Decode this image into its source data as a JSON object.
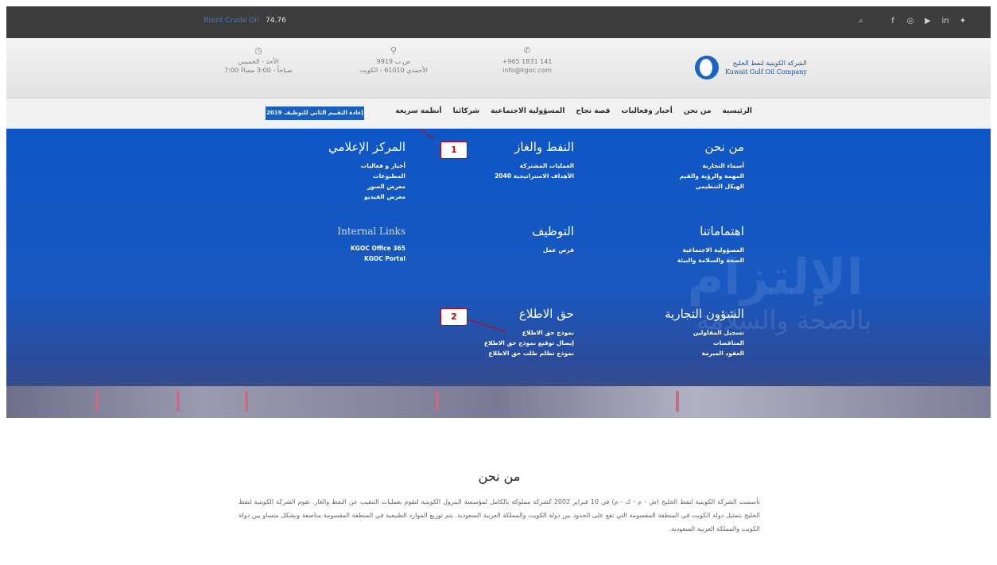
{
  "topbar": {
    "ticker_label": "Brent Crude Oil",
    "ticker_value": "74.76",
    "social_icons": [
      "search-icon",
      "facebook-icon",
      "instagram-icon",
      "youtube-icon",
      "linkedin-icon",
      "twitter-icon"
    ]
  },
  "header": {
    "logo_ar": "الشركة الكويتية لنفط الخليج",
    "logo_en": "Kuwait Gulf Oil Company",
    "hours_line1": "الأحد - الخميس",
    "hours_line2": "7:00 صباحاً - 3:00 مساءً",
    "address_line1": "ص.ب 9919",
    "address_line2": "الأحمدي 61010 - الكويت",
    "contact_line1": "+965 1831 141",
    "contact_line2": "info@kgoc.com"
  },
  "nav": {
    "items": [
      "الرئيسية",
      "من نحن",
      "أخبار وفعاليات",
      "قصة نجاح",
      "المسؤولية الاجتماعية",
      "شركائنا",
      "أنظمة سريعة"
    ],
    "cta": "إعادة التقييم الثاني للتوظيف 2019"
  },
  "mega": {
    "about": {
      "title": "من نحن",
      "links": [
        "أسماء التجارية",
        "المهمة والرؤية والقيم",
        "الهيكل التنظيمي"
      ]
    },
    "oil_gas": {
      "title": "النفط والغاز",
      "links": [
        "العمليات المشتركة",
        "الأهداف الاستراتيجية 2040"
      ]
    },
    "media": {
      "title": "المركز الإعلامي",
      "links": [
        "أخبار و فعاليات",
        "المطبوعات",
        "معرض الصور",
        "معرض الفيديو"
      ]
    },
    "interests": {
      "title": "اهتماماتنا",
      "links": [
        "المسؤولية الاجتماعية",
        "الصحة والسلامة والبيئة"
      ]
    },
    "jobs": {
      "title": "التوظيف",
      "links": [
        "فرص عمل"
      ]
    },
    "internal": {
      "title": "Internal Links",
      "links": [
        "KGOC Office 365",
        "KGOC Portal"
      ]
    },
    "business": {
      "title": "الشؤون التجارية",
      "links": [
        "تسجيل المقاولين",
        "المناقصات",
        "العقود المبرمة"
      ]
    },
    "access": {
      "title": "حق الاطلاع",
      "links": [
        "نموذج حق الاطلاع",
        "إيصال توقيع نموذج حق الاطلاع",
        "نموذج تظلم طلب حق الاطلاع"
      ]
    },
    "badge1": "1",
    "badge2": "2"
  },
  "content": {
    "title": "من نحن",
    "paragraph": "تأسست الشركة الكويتية لنفط الخليج (ش - م - ك - م) في 10 فبراير 2002 كشركة مملوكة بالكامل لمؤسسة البترول الكويتية لتقوم بعمليات التنقيب عن النفط والغاز. تقوم الشركة الكويتية لنفط الخليج بتمثيل دولة الكويت في المنطقة المقسومة التي تقع على الحدود بين دولة الكويت والمملكة العربية السعودية. يتم توزيع الموارد الطبيعية في المنطقة المقسومة مناصفة وبشكل متساو بين دولة الكويت والمملكة العربية السعودية."
  }
}
